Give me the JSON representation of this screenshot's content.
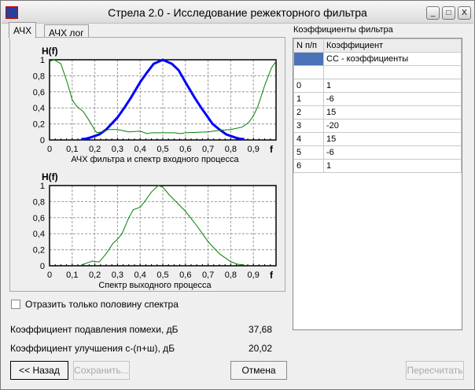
{
  "window": {
    "title": "Стрела 2.0 - Исследование режекторного фильтра",
    "minimize": "_",
    "maximize": "□",
    "close": "X"
  },
  "tabs": [
    {
      "label": "АЧХ"
    },
    {
      "label": "АЧХ лог"
    }
  ],
  "coef_panel": {
    "title": "Коэффициенты фильтра",
    "headers": [
      "N п/п",
      "Коэффициент"
    ],
    "type_row": "СС - коэффициенты",
    "rows": [
      [
        "0",
        "1"
      ],
      [
        "1",
        "-6"
      ],
      [
        "2",
        "15"
      ],
      [
        "3",
        "-20"
      ],
      [
        "4",
        "15"
      ],
      [
        "5",
        "-6"
      ],
      [
        "6",
        "1"
      ]
    ]
  },
  "checkbox": {
    "label": "Отразить только половину спектра",
    "checked": false
  },
  "metrics": [
    {
      "label": "Коэффициент подавления помехи, дБ",
      "value": "37,68"
    },
    {
      "label": "Коэффициент улучшения с-(п+ш), дБ",
      "value": "20,02"
    }
  ],
  "buttons": {
    "back": "<< Назад",
    "save": "Сохранить...",
    "cancel": "Отмена",
    "recalc": "Пересчитать"
  },
  "colors": {
    "filter": "#0000ff",
    "spectrum": "#008000"
  },
  "chart_data": [
    {
      "type": "line",
      "ylabel": "H(f)",
      "xlabel": "f",
      "title": "АЧХ фильтра и спектр входного процесса",
      "xlim": [
        0,
        1
      ],
      "ylim": [
        0,
        1
      ],
      "xticks": [
        "0",
        "0,1",
        "0,2",
        "0,3",
        "0,4",
        "0,5",
        "0,6",
        "0,7",
        "0,8",
        "0,9"
      ],
      "yticks": [
        "0",
        "0,2",
        "0,4",
        "0,6",
        "0,8",
        "1"
      ],
      "series": [
        {
          "name": "filter",
          "x": [
            0.14,
            0.16,
            0.18,
            0.2,
            0.22,
            0.25,
            0.28,
            0.3,
            0.33,
            0.36,
            0.4,
            0.43,
            0.46,
            0.5,
            0.54,
            0.57,
            0.6,
            0.64,
            0.67,
            0.7,
            0.72,
            0.75,
            0.78,
            0.8,
            0.82,
            0.84,
            0.86
          ],
          "y": [
            0.01,
            0.015,
            0.03,
            0.05,
            0.07,
            0.13,
            0.22,
            0.28,
            0.4,
            0.53,
            0.72,
            0.84,
            0.95,
            1.0,
            0.95,
            0.87,
            0.72,
            0.53,
            0.4,
            0.28,
            0.2,
            0.13,
            0.07,
            0.05,
            0.03,
            0.015,
            0.01
          ]
        },
        {
          "name": "input spectrum",
          "x": [
            0,
            0.02,
            0.05,
            0.08,
            0.1,
            0.12,
            0.15,
            0.18,
            0.2,
            0.21,
            0.23,
            0.26,
            0.3,
            0.35,
            0.4,
            0.43,
            0.45,
            0.5,
            0.55,
            0.58,
            0.6,
            0.7,
            0.75,
            0.8,
            0.85,
            0.88,
            0.9,
            0.92,
            0.95,
            0.98,
            1.0
          ],
          "y": [
            0.98,
            1.0,
            0.95,
            0.7,
            0.5,
            0.42,
            0.35,
            0.22,
            0.12,
            0.09,
            0.1,
            0.13,
            0.13,
            0.1,
            0.11,
            0.08,
            0.09,
            0.09,
            0.09,
            0.08,
            0.09,
            0.1,
            0.12,
            0.13,
            0.16,
            0.22,
            0.3,
            0.42,
            0.68,
            0.9,
            0.98
          ]
        }
      ]
    },
    {
      "type": "line",
      "ylabel": "H(f)",
      "xlabel": "f",
      "title": "Спектр выходного процесса",
      "xlim": [
        0,
        1
      ],
      "ylim": [
        0,
        1
      ],
      "xticks": [
        "0",
        "0,1",
        "0,2",
        "0,3",
        "0,4",
        "0,5",
        "0,6",
        "0,7",
        "0,8",
        "0,9"
      ],
      "yticks": [
        "0",
        "0,2",
        "0,4",
        "0,6",
        "0,8",
        "1"
      ],
      "series": [
        {
          "name": "output spectrum",
          "x": [
            0.14,
            0.17,
            0.19,
            0.2,
            0.22,
            0.25,
            0.28,
            0.3,
            0.32,
            0.35,
            0.37,
            0.4,
            0.42,
            0.45,
            0.48,
            0.5,
            0.53,
            0.6,
            0.65,
            0.7,
            0.75,
            0.8,
            0.83,
            0.86
          ],
          "y": [
            0.01,
            0.04,
            0.06,
            0.05,
            0.05,
            0.15,
            0.28,
            0.33,
            0.4,
            0.6,
            0.7,
            0.73,
            0.8,
            0.92,
            1.0,
            0.98,
            0.88,
            0.68,
            0.5,
            0.3,
            0.15,
            0.05,
            0.02,
            0.01
          ]
        }
      ]
    }
  ]
}
